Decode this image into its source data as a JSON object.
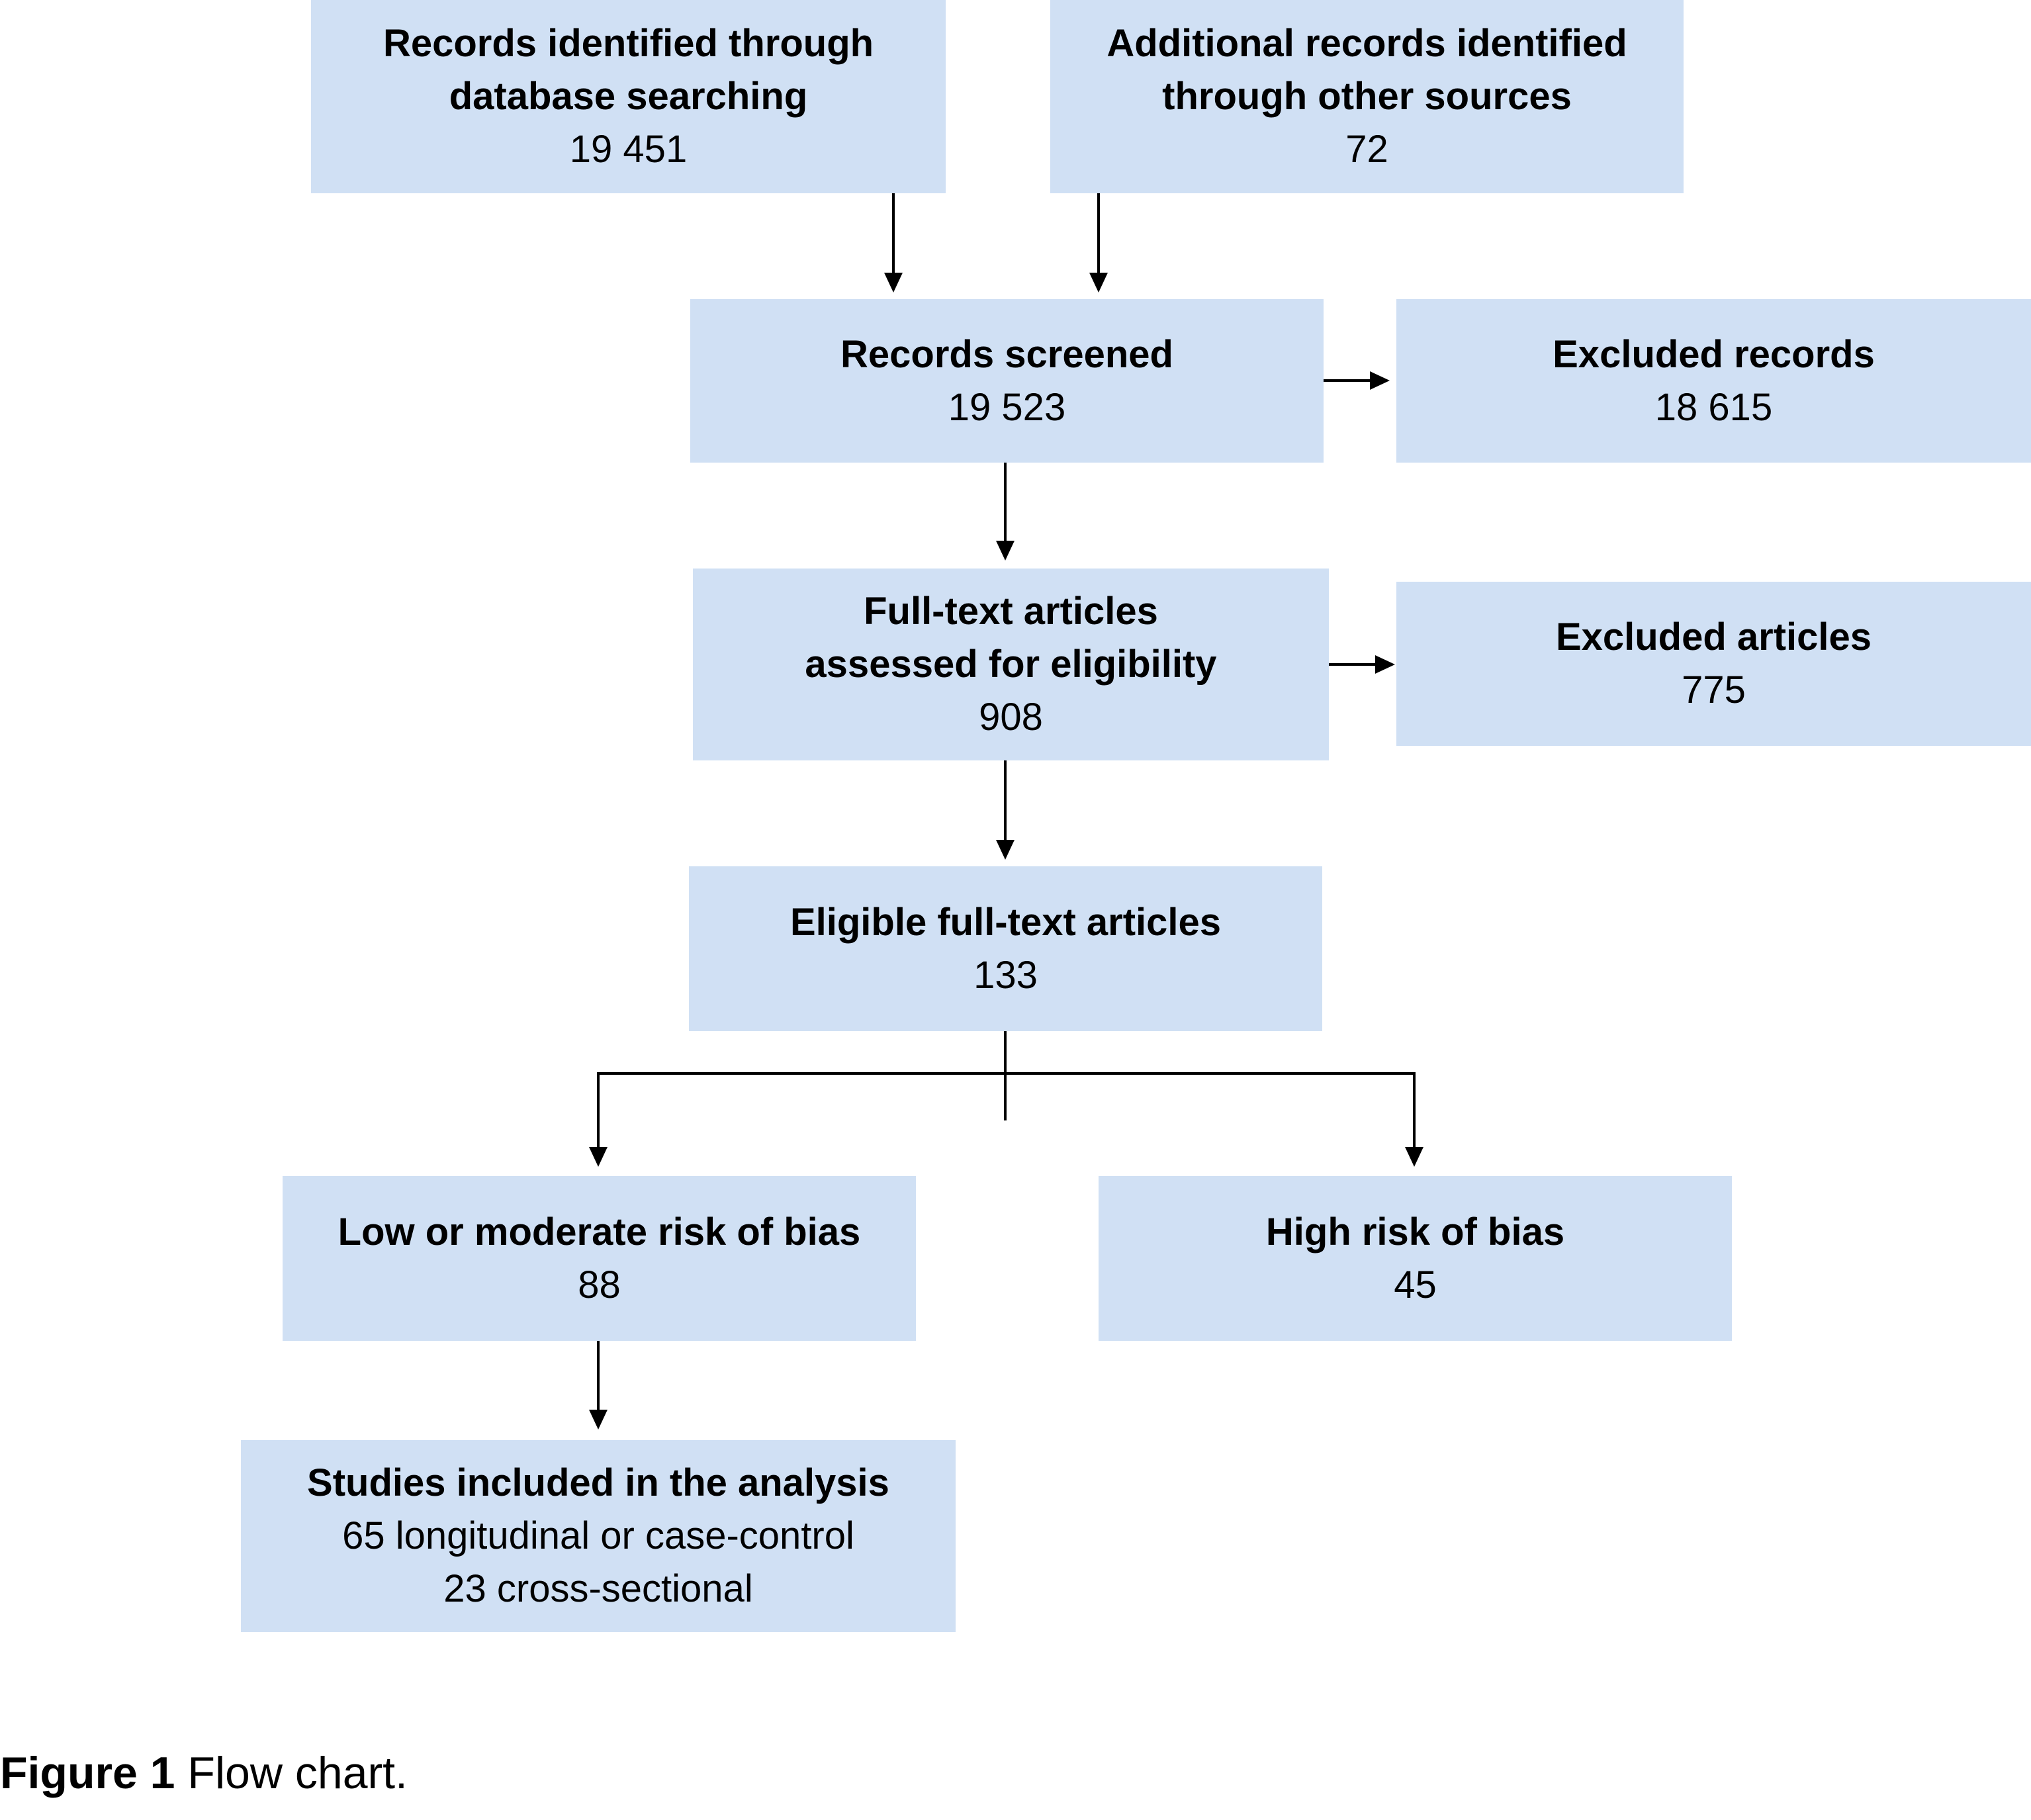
{
  "boxes": {
    "db_search": {
      "title": [
        "Records identified through",
        "database searching"
      ],
      "count": "19 451"
    },
    "other_sources": {
      "title": [
        "Additional records identified",
        "through other sources"
      ],
      "count": "72"
    },
    "screened": {
      "title": [
        "Records screened"
      ],
      "count": "19 523"
    },
    "excluded_records": {
      "title": [
        "Excluded records"
      ],
      "count": "18 615"
    },
    "full_text": {
      "title": [
        "Full-text articles",
        "assessed for eligibility"
      ],
      "count": "908"
    },
    "excluded_articles": {
      "title": [
        "Excluded articles"
      ],
      "count": "775"
    },
    "eligible": {
      "title": [
        "Eligible full-text articles"
      ],
      "count": "133"
    },
    "low_risk": {
      "title": [
        "Low or moderate risk of bias"
      ],
      "count": "88"
    },
    "high_risk": {
      "title": [
        "High risk of bias"
      ],
      "count": "45"
    },
    "included": {
      "title": [
        "Studies included in the analysis"
      ],
      "lines": [
        "65 longitudinal or case-control",
        "23 cross-sectional"
      ]
    }
  },
  "caption": {
    "label": "Figure 1",
    "text": "Flow chart."
  },
  "colors": {
    "box_fill": "#d0e0f4",
    "arrow": "#000000"
  }
}
